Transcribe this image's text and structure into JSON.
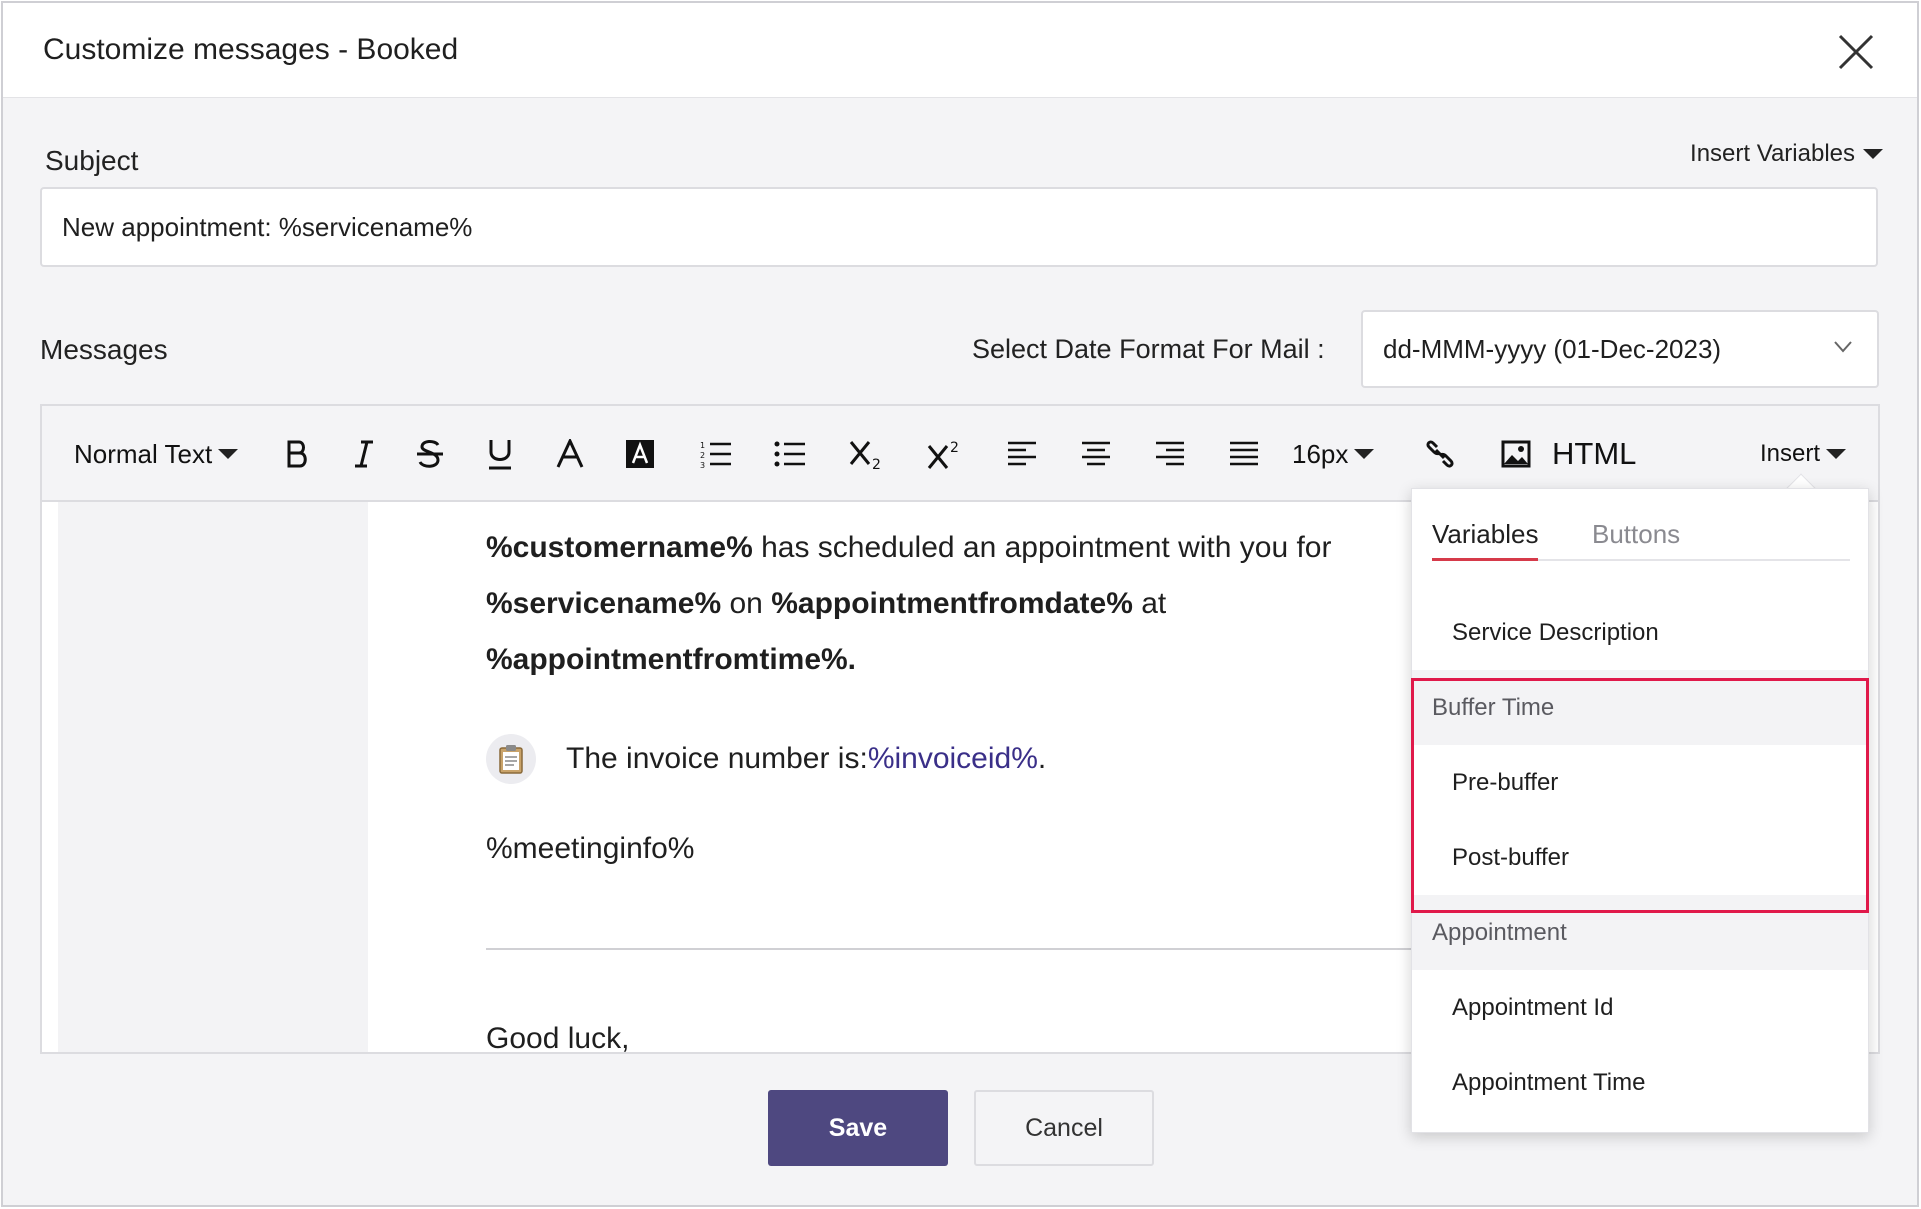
{
  "dialog": {
    "title": "Customize messages - Booked",
    "close_icon": "close-icon"
  },
  "subject": {
    "label": "Subject",
    "insert_variables_label": "Insert Variables",
    "value": "New appointment: %servicename%"
  },
  "messages": {
    "label": "Messages",
    "date_format_label": "Select Date Format For Mail :",
    "date_format_value": "dd-MMM-yyyy (01-Dec-2023)"
  },
  "toolbar": {
    "text_style": "Normal Text",
    "font_size": "16px",
    "html_label": "HTML",
    "insert_label": "Insert",
    "icons": [
      "bold-icon",
      "italic-icon",
      "strikethrough-icon",
      "underline-icon",
      "font-color-icon",
      "highlight-color-icon",
      "ordered-list-icon",
      "unordered-list-icon",
      "subscript-icon",
      "superscript-icon",
      "align-left-icon",
      "align-center-icon",
      "align-right-icon",
      "justify-icon",
      "link-icon",
      "image-icon"
    ]
  },
  "editor": {
    "line1_var1": "%customername%",
    "line1_text": " has scheduled an appointment with you for",
    "line2_var1": "%servicename%",
    "line2_text1": " on ",
    "line2_var2": "%appointmentfromdate%",
    "line2_text2": " at",
    "line3_var": "%appointmentfromtime%.",
    "invoice_text": "The invoice number is:",
    "invoice_var": "%invoiceid%",
    "invoice_end": ".",
    "meeting_info": "%meetinginfo%",
    "closing": "Good luck,"
  },
  "insert_popup": {
    "tabs": [
      {
        "label": "Variables",
        "active": true
      },
      {
        "label": "Buttons",
        "active": false
      }
    ],
    "items": {
      "service_description": "Service Description",
      "group_buffer": "Buffer Time",
      "pre_buffer": "Pre-buffer",
      "post_buffer": "Post-buffer",
      "group_appointment": "Appointment",
      "appointment_id": "Appointment Id",
      "appointment_time": "Appointment Time"
    }
  },
  "actions": {
    "save_label": "Save",
    "cancel_label": "Cancel"
  },
  "colors": {
    "primary": "#4e4880",
    "tab_active_underline": "#d63a4a",
    "highlight_border": "#e0194a",
    "variable_link": "#3a2f88"
  }
}
